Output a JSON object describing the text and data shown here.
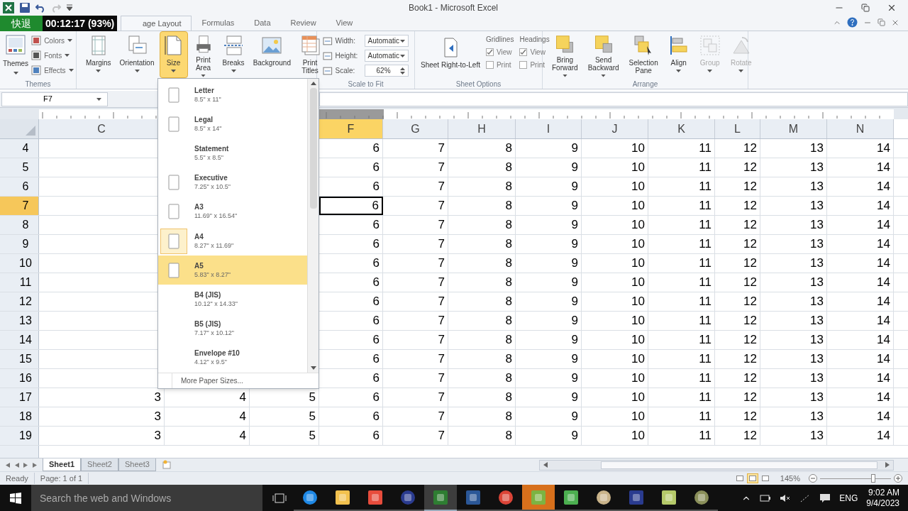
{
  "title_bar": {
    "title": "Book1  -  Microsoft Excel"
  },
  "recorder_overlay": {
    "label": "快退",
    "timer": "00:12:17 (93%)"
  },
  "ribbon_tabs": [
    {
      "label": "age Layout",
      "selected": true
    },
    {
      "label": "Formulas",
      "selected": false
    },
    {
      "label": "Data",
      "selected": false
    },
    {
      "label": "Review",
      "selected": false
    },
    {
      "label": "View",
      "selected": false
    }
  ],
  "themes_group": {
    "label": "Themes",
    "main": "Themes",
    "options": [
      "Colors",
      "Fonts",
      "Effects"
    ]
  },
  "page_setup_group": {
    "buttons": [
      {
        "label": "Margins",
        "menu": true,
        "selected": false
      },
      {
        "label": "Orientation",
        "menu": true,
        "selected": false
      },
      {
        "label": "Size",
        "menu": true,
        "selected": true
      },
      {
        "label": "Print Area",
        "menu": true,
        "selected": false
      },
      {
        "label": "Breaks",
        "menu": true,
        "selected": false
      },
      {
        "label": "Background",
        "menu": false,
        "selected": false
      },
      {
        "label": "Print Titles",
        "menu": false,
        "selected": false
      }
    ]
  },
  "scale_group": {
    "label": "Scale to Fit",
    "fields": [
      {
        "label": "Width:",
        "value": "Automatic",
        "kind": "dropdown"
      },
      {
        "label": "Height:",
        "value": "Automatic",
        "kind": "dropdown"
      },
      {
        "label": "Scale:",
        "value": "62%",
        "kind": "spinner"
      }
    ]
  },
  "sheet_options_group": {
    "label": "Sheet Options",
    "button": "Sheet Right-to-Left",
    "sections": [
      {
        "title": "Gridlines",
        "options": [
          {
            "label": "View",
            "checked": true
          },
          {
            "label": "Print",
            "checked": false
          }
        ]
      },
      {
        "title": "Headings",
        "options": [
          {
            "label": "View",
            "checked": true
          },
          {
            "label": "Print",
            "checked": false
          }
        ]
      }
    ]
  },
  "arrange_group": {
    "label": "Arrange",
    "buttons": [
      {
        "label": "Bring Forward",
        "menu": true,
        "disabled": false
      },
      {
        "label": "Send Backward",
        "menu": true,
        "disabled": false
      },
      {
        "label": "Selection Pane",
        "menu": false,
        "disabled": false
      },
      {
        "label": "Align",
        "menu": true,
        "disabled": false
      },
      {
        "label": "Group",
        "menu": true,
        "disabled": true
      },
      {
        "label": "Rotate",
        "menu": true,
        "disabled": true
      }
    ]
  },
  "formula_bar": {
    "name_box": "F7"
  },
  "grid": {
    "columns": [
      {
        "label": "C",
        "selected": false
      },
      {
        "label": "F",
        "selected": true
      },
      {
        "label": "G",
        "selected": false
      },
      {
        "label": "H",
        "selected": false
      },
      {
        "label": "I",
        "selected": false
      },
      {
        "label": "J",
        "selected": false
      },
      {
        "label": "K",
        "selected": false
      },
      {
        "label": "L",
        "selected": false
      },
      {
        "label": "M",
        "selected": false
      },
      {
        "label": "N",
        "selected": false
      }
    ],
    "rows": [
      {
        "header": "4",
        "selected": false,
        "cells": [
          "6",
          "7",
          "8",
          "9",
          "10",
          "11",
          "12",
          "13",
          "14"
        ]
      },
      {
        "header": "5",
        "selected": false,
        "cells": [
          "6",
          "7",
          "8",
          "9",
          "10",
          "11",
          "12",
          "13",
          "14"
        ]
      },
      {
        "header": "6",
        "selected": false,
        "cells": [
          "6",
          "7",
          "8",
          "9",
          "10",
          "11",
          "12",
          "13",
          "14"
        ]
      },
      {
        "header": "7",
        "selected": true,
        "cells": [
          "6",
          "7",
          "8",
          "9",
          "10",
          "11",
          "12",
          "13",
          "14"
        ]
      },
      {
        "header": "8",
        "selected": false,
        "cells": [
          "6",
          "7",
          "8",
          "9",
          "10",
          "11",
          "12",
          "13",
          "14"
        ]
      },
      {
        "header": "9",
        "selected": false,
        "cells": [
          "6",
          "7",
          "8",
          "9",
          "10",
          "11",
          "12",
          "13",
          "14"
        ]
      },
      {
        "header": "10",
        "selected": false,
        "cells": [
          "6",
          "7",
          "8",
          "9",
          "10",
          "11",
          "12",
          "13",
          "14"
        ]
      },
      {
        "header": "11",
        "selected": false,
        "cells": [
          "6",
          "7",
          "8",
          "9",
          "10",
          "11",
          "12",
          "13",
          "14"
        ]
      },
      {
        "header": "12",
        "selected": false,
        "cells": [
          "6",
          "7",
          "8",
          "9",
          "10",
          "11",
          "12",
          "13",
          "14"
        ]
      },
      {
        "header": "13",
        "selected": false,
        "cells": [
          "6",
          "7",
          "8",
          "9",
          "10",
          "11",
          "12",
          "13",
          "14"
        ]
      },
      {
        "header": "14",
        "selected": false,
        "cells": [
          "6",
          "7",
          "8",
          "9",
          "10",
          "11",
          "12",
          "13",
          "14"
        ]
      },
      {
        "header": "15",
        "selected": false,
        "cells": [
          "6",
          "7",
          "8",
          "9",
          "10",
          "11",
          "12",
          "13",
          "14"
        ]
      },
      {
        "header": "16",
        "selected": false,
        "cells": [
          "6",
          "7",
          "8",
          "9",
          "10",
          "11",
          "12",
          "13",
          "14"
        ]
      },
      {
        "header": "17",
        "selected": false,
        "left_cells": [
          "3",
          "4",
          "5"
        ],
        "cells": [
          "6",
          "7",
          "8",
          "9",
          "10",
          "11",
          "12",
          "13",
          "14"
        ]
      },
      {
        "header": "18",
        "selected": false,
        "left_cells": [
          "3",
          "4",
          "5"
        ],
        "cells": [
          "6",
          "7",
          "8",
          "9",
          "10",
          "11",
          "12",
          "13",
          "14"
        ]
      },
      {
        "header": "19",
        "selected": false,
        "left_cells": [
          "3",
          "4",
          "5"
        ],
        "cells": [
          "6",
          "7",
          "8",
          "9",
          "10",
          "11",
          "12",
          "13",
          "14"
        ]
      }
    ]
  },
  "size_menu": {
    "items": [
      {
        "name": "Letter",
        "size": "8.5\" x 11\"",
        "kind": "page",
        "selected": false,
        "highlighted": false
      },
      {
        "name": "Legal",
        "size": "8.5\" x 14\"",
        "kind": "page",
        "selected": false,
        "highlighted": false
      },
      {
        "name": "Statement",
        "size": "5.5\" x 8.5\"",
        "kind": "plain",
        "selected": false,
        "highlighted": false
      },
      {
        "name": "Executive",
        "size": "7.25\" x 10.5\"",
        "kind": "page",
        "selected": false,
        "highlighted": false
      },
      {
        "name": "A3",
        "size": "11.69\" x 16.54\"",
        "kind": "page",
        "selected": false,
        "highlighted": false
      },
      {
        "name": "A4",
        "size": "8.27\" x 11.69\"",
        "kind": "page",
        "selected": true,
        "highlighted": false
      },
      {
        "name": "A5",
        "size": "5.83\" x 8.27\"",
        "kind": "page",
        "selected": false,
        "highlighted": true
      },
      {
        "name": "B4 (JIS)",
        "size": "10.12\" x 14.33\"",
        "kind": "plain",
        "selected": false,
        "highlighted": false
      },
      {
        "name": "B5 (JIS)",
        "size": "7.17\" x 10.12\"",
        "kind": "plain",
        "selected": false,
        "highlighted": false
      },
      {
        "name": "Envelope #10",
        "size": "4.12\" x 9.5\"",
        "kind": "plain",
        "selected": false,
        "highlighted": false
      }
    ],
    "footer": "More Paper Sizes..."
  },
  "sheet_tabs": [
    {
      "label": "Sheet1",
      "selected": true
    },
    {
      "label": "Sheet2",
      "selected": false
    },
    {
      "label": "Sheet3",
      "selected": false
    }
  ],
  "status_bar": {
    "mode": "Ready",
    "page": "Page: 1 of 1",
    "view_buttons": [
      {
        "selected": false
      },
      {
        "selected": true
      },
      {
        "selected": false
      }
    ],
    "zoom": "145%",
    "zoom_slider": {
      "level": 0.75
    }
  },
  "taskbar": {
    "search_placeholder": "Search the web and Windows",
    "apps": [
      {
        "focused": false,
        "flashing": false
      },
      {
        "focused": false,
        "flashing": false
      },
      {
        "focused": false,
        "flashing": false
      },
      {
        "focused": false,
        "flashing": false
      },
      {
        "focused": true,
        "flashing": false
      },
      {
        "focused": false,
        "flashing": false
      },
      {
        "focused": false,
        "flashing": false
      },
      {
        "focused": false,
        "flashing": true
      },
      {
        "focused": false,
        "flashing": false
      },
      {
        "focused": false,
        "flashing": false
      },
      {
        "focused": false,
        "flashing": false
      },
      {
        "focused": false,
        "flashing": false
      },
      {
        "focused": false,
        "flashing": false
      }
    ],
    "language": "ENG",
    "time": "9:02 AM",
    "date": "9/4/2023"
  }
}
